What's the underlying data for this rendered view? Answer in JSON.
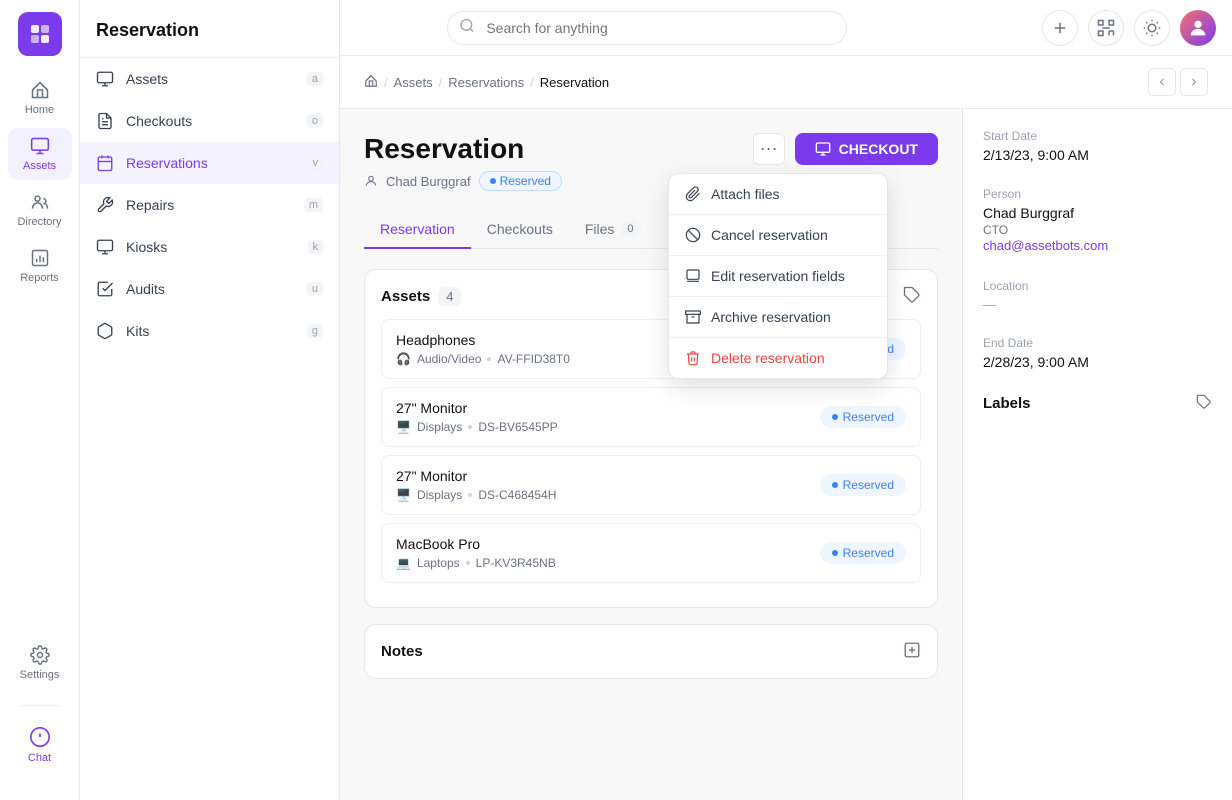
{
  "app": {
    "logo_alt": "AssetBots Logo"
  },
  "icon_nav": {
    "items": [
      {
        "id": "home",
        "label": "Home"
      },
      {
        "id": "assets",
        "label": "Assets",
        "active": true
      },
      {
        "id": "directory",
        "label": "Directory"
      },
      {
        "id": "reports",
        "label": "Reports"
      },
      {
        "id": "settings",
        "label": "Settings"
      }
    ],
    "chat_label": "Chat"
  },
  "sidebar": {
    "title": "Reservation",
    "items": [
      {
        "id": "assets",
        "label": "Assets",
        "shortcut": "a"
      },
      {
        "id": "checkouts",
        "label": "Checkouts",
        "shortcut": "o"
      },
      {
        "id": "reservations",
        "label": "Reservations",
        "shortcut": "v",
        "active": true
      },
      {
        "id": "repairs",
        "label": "Repairs",
        "shortcut": "m"
      },
      {
        "id": "kiosks",
        "label": "Kiosks",
        "shortcut": "k"
      },
      {
        "id": "audits",
        "label": "Audits",
        "shortcut": "u"
      },
      {
        "id": "kits",
        "label": "Kits",
        "shortcut": "g"
      }
    ]
  },
  "topbar": {
    "search_placeholder": "Search for anything",
    "add_tooltip": "Add",
    "scan_tooltip": "Scan",
    "theme_tooltip": "Toggle theme"
  },
  "breadcrumb": {
    "items": [
      {
        "label": "Home",
        "icon": true
      },
      {
        "label": "Assets"
      },
      {
        "label": "Reservations"
      },
      {
        "label": "Reservation",
        "active": true
      }
    ]
  },
  "page": {
    "title": "Reservation",
    "person_name": "Chad Burggraf",
    "status": "Reserved",
    "tabs": [
      {
        "id": "reservation",
        "label": "Reservation",
        "active": true
      },
      {
        "id": "checkouts",
        "label": "Checkouts"
      },
      {
        "id": "files",
        "label": "Files",
        "count": "0"
      }
    ],
    "checkout_btn": "CHECKOUT"
  },
  "dropdown": {
    "items": [
      {
        "id": "attach",
        "label": "Attach files",
        "icon": "paperclip"
      },
      {
        "id": "cancel",
        "label": "Cancel reservation",
        "icon": "cancel"
      },
      {
        "id": "edit",
        "label": "Edit reservation fields",
        "icon": "edit"
      },
      {
        "id": "archive",
        "label": "Archive reservation",
        "icon": "archive"
      },
      {
        "id": "delete",
        "label": "Delete reservation",
        "icon": "trash",
        "danger": true
      }
    ]
  },
  "assets_section": {
    "title": "Assets",
    "count": "4",
    "items": [
      {
        "name": "Headphones",
        "category": "Audio/Video",
        "tag": "AV-FFID38T0",
        "status": "Reserved",
        "icon_type": "headphone"
      },
      {
        "name": "27\" Monitor",
        "category": "Displays",
        "tag": "DS-BV6545PP",
        "status": "Reserved",
        "icon_type": "monitor"
      },
      {
        "name": "27\" Monitor",
        "category": "Displays",
        "tag": "DS-C468454H",
        "status": "Reserved",
        "icon_type": "monitor"
      },
      {
        "name": "MacBook Pro",
        "category": "Laptops",
        "tag": "LP-KV3R45NB",
        "status": "Reserved",
        "icon_type": "laptop"
      }
    ]
  },
  "notes_section": {
    "title": "Notes"
  },
  "right_panel": {
    "start_date_label": "Start Date",
    "start_date_value": "2/13/23, 9:00 AM",
    "person_label": "Person",
    "person_name": "Chad Burggraf",
    "person_role": "CTO",
    "person_email": "chad@assetbots.com",
    "location_label": "Location",
    "location_value": "",
    "end_date_label": "End Date",
    "end_date_value": "2/28/23, 9:00 AM",
    "labels_title": "Labels"
  }
}
